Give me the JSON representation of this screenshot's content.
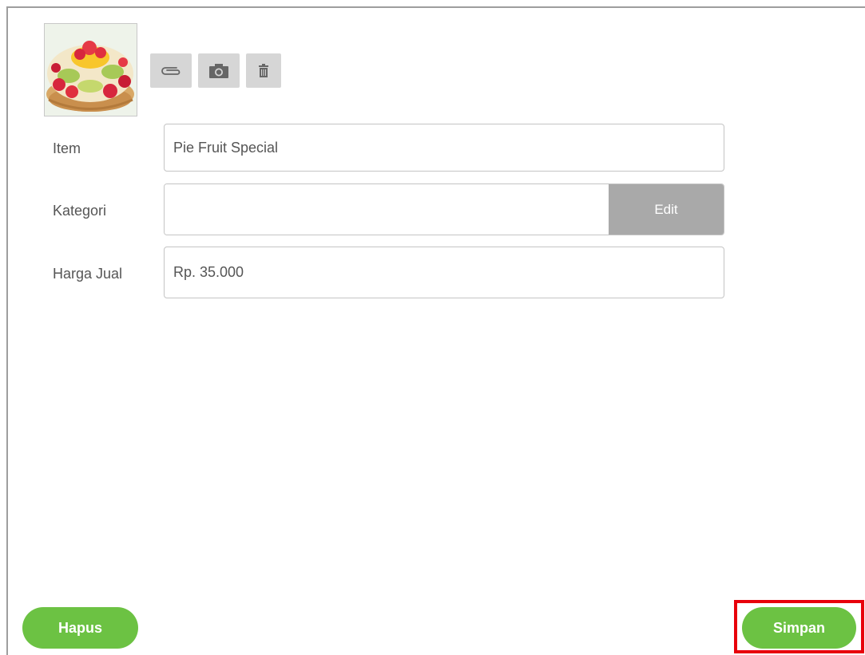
{
  "product": {
    "image_icon": "fruit-pie-photo",
    "toolbar": {
      "attach_icon": "paperclip-icon",
      "camera_icon": "camera-icon",
      "delete_icon": "trash-icon"
    }
  },
  "form": {
    "item_label": "Item",
    "item_value": "Pie Fruit Special",
    "category_label": "Kategori",
    "category_value": "",
    "category_edit_label": "Edit",
    "price_label": "Harga Jual",
    "price_value": "Rp. 35.000"
  },
  "footer": {
    "delete_label": "Hapus",
    "save_label": "Simpan"
  },
  "colors": {
    "accent_green": "#6cc243",
    "highlight_red": "#e8000b",
    "edit_gray": "#a9a9a9",
    "tool_gray": "#d6d6d6"
  }
}
